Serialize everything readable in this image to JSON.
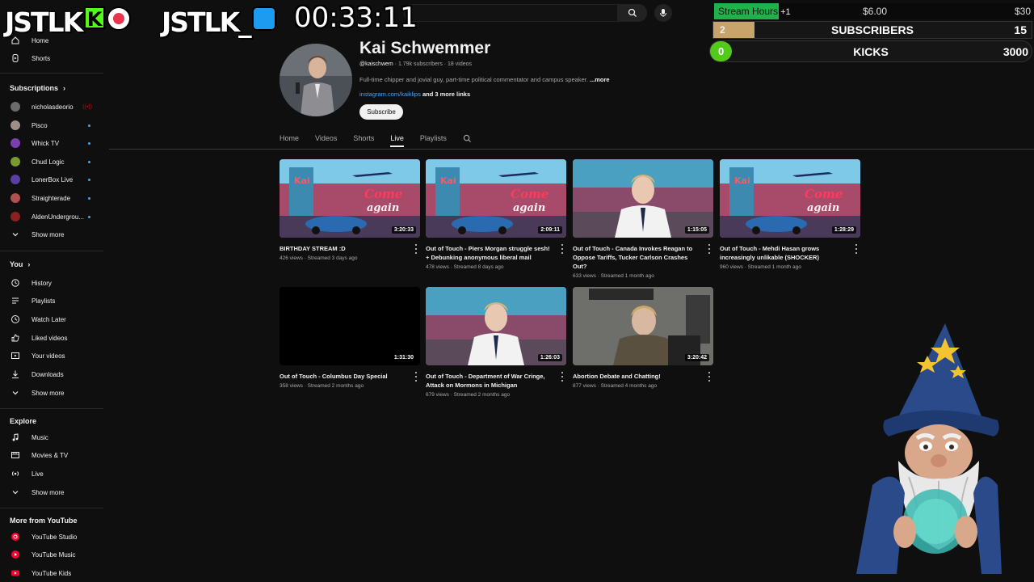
{
  "sidebar": {
    "top": [
      {
        "label": "Home",
        "icon": "home-icon"
      },
      {
        "label": "Shorts",
        "icon": "shorts-icon"
      }
    ],
    "subscriptions_heading": "Subscriptions",
    "subscriptions": [
      {
        "label": "nicholasdeorio",
        "avatar_color": "#6b6b6b",
        "live": true
      },
      {
        "label": "Pisco",
        "avatar_color": "#9d8e86",
        "live": false
      },
      {
        "label": "Whick TV",
        "avatar_color": "#7b3fb0",
        "live": false
      },
      {
        "label": "Chud Logic",
        "avatar_color": "#7a9a30",
        "live": false
      },
      {
        "label": "LonerBox Live",
        "avatar_color": "#5a3fa0",
        "live": false
      },
      {
        "label": "Straighterade",
        "avatar_color": "#b05050",
        "live": false
      },
      {
        "label": "AldenUndergrou...",
        "avatar_color": "#8a2020",
        "live": false
      }
    ],
    "show_more_1": "Show more",
    "you_heading": "You",
    "you_items": [
      {
        "label": "History",
        "icon": "history-icon"
      },
      {
        "label": "Playlists",
        "icon": "playlists-icon"
      },
      {
        "label": "Watch Later",
        "icon": "watch-later-icon"
      },
      {
        "label": "Liked videos",
        "icon": "like-icon"
      },
      {
        "label": "Your videos",
        "icon": "your-videos-icon"
      },
      {
        "label": "Downloads",
        "icon": "download-icon"
      }
    ],
    "show_more_2": "Show more",
    "explore_heading": "Explore",
    "explore_items": [
      {
        "label": "Music",
        "icon": "music-icon"
      },
      {
        "label": "Movies & TV",
        "icon": "movies-icon"
      },
      {
        "label": "Live",
        "icon": "live-icon"
      }
    ],
    "show_more_3": "Show more",
    "more_heading": "More from YouTube",
    "more_items": [
      {
        "label": "YouTube Studio",
        "icon": "youtube-studio-icon"
      },
      {
        "label": "YouTube Music",
        "icon": "youtube-music-icon"
      },
      {
        "label": "YouTube Kids",
        "icon": "youtube-kids-icon"
      }
    ]
  },
  "channel": {
    "name": "Kai Schwemmer",
    "handle": "@kaischwem",
    "meta_rest": " · 1.79k subscribers · 18 videos",
    "description": "Full-time chipper and jovial guy, part-time political commentator and campus speaker.",
    "more_label": "...more",
    "link": "instagram.com/kaiklips",
    "more_links": " and 3 more links",
    "subscribe_label": "Subscribe"
  },
  "tabs": [
    "Home",
    "Videos",
    "Shorts",
    "Live",
    "Playlists"
  ],
  "active_tab": "Live",
  "videos": [
    {
      "title": "BIRTHDAY STREAM :D",
      "meta": "426 views · Streamed 3 days ago",
      "duration": "3:20:33",
      "thumb": "diner-sign"
    },
    {
      "title": "Out of Touch - Piers Morgan struggle sesh! + Debunking anonymous liberal mail",
      "meta": "478 views · Streamed 8 days ago",
      "duration": "2:09:11",
      "thumb": "diner-sign"
    },
    {
      "title": "Out of Touch - Canada Invokes Reagan to Oppose Tariffs, Tucker Carlson Crashes Out?",
      "meta": "633 views · Streamed 1 month ago",
      "duration": "1:15:05",
      "thumb": "person-diner"
    },
    {
      "title": "Out of Touch - Mehdi Hasan grows increasingly unlikable (SHOCKER)",
      "meta": "960 views · Streamed 1 month ago",
      "duration": "1:28:29",
      "thumb": "diner-sign"
    },
    {
      "title": "Out of Touch - Columbus Day Special",
      "meta": "358 views · Streamed 2 months ago",
      "duration": "1:31:30",
      "thumb": "black"
    },
    {
      "title": "Out of Touch - Department of War Cringe, Attack on Mormons in Michigan",
      "meta": "679 views · Streamed 2 months ago",
      "duration": "1:26:03",
      "thumb": "person-diner"
    },
    {
      "title": "Abortion Debate and Chatting!",
      "meta": "877 views · Streamed 4 months ago",
      "duration": "3:20:42",
      "thumb": "person-room"
    }
  ],
  "overlay": {
    "logo1_text": "JSTLK",
    "logo1_k": "K",
    "logo2_text": "JSTLK_",
    "timer": "00:33:11",
    "stream_hours": {
      "label": "Stream Hours",
      "plus": " +1",
      "amount": "$6.00",
      "goal": "$30",
      "progress": 0.2
    },
    "subscribers": {
      "count": "2",
      "label": "SUBSCRIBERS",
      "goal": "15",
      "progress": 0.13
    },
    "kicks": {
      "count": "0",
      "label": "KICKS",
      "goal": "3000",
      "progress": 0.0
    }
  },
  "colors": {
    "accent_blue": "#3ea6ff",
    "kick_green": "#53fc18",
    "background": "#0f0f0f"
  }
}
